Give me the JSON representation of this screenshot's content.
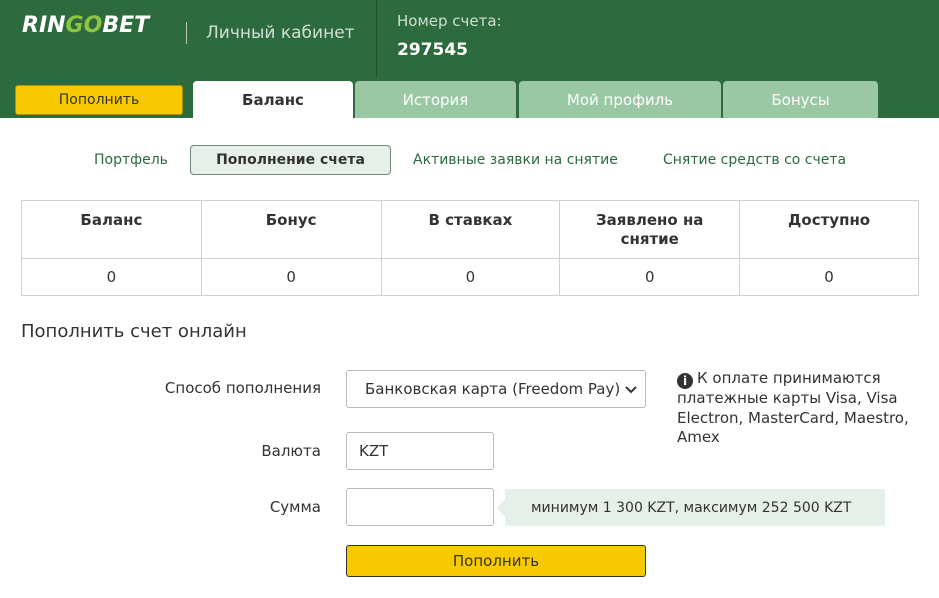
{
  "header": {
    "logo": {
      "part1": "RIN",
      "part2": "GO",
      "part3": "BET"
    },
    "cabinet_label": "Личный кабинет",
    "account_label": "Номер счета:",
    "account_number": "297545"
  },
  "tabs": {
    "topup_button": "Пополнить",
    "items": [
      {
        "label": "Баланс",
        "active": true
      },
      {
        "label": "История",
        "active": false
      },
      {
        "label": "Мой профиль",
        "active": false
      },
      {
        "label": "Бонусы",
        "active": false
      }
    ]
  },
  "subnav": [
    {
      "label": "Портфель",
      "active": false
    },
    {
      "label": "Пополнение счета",
      "active": true
    },
    {
      "label": "Активные заявки на снятие",
      "active": false
    },
    {
      "label": "Снятие средств со счета",
      "active": false
    }
  ],
  "balance_table": {
    "headers": [
      "Баланс",
      "Бонус",
      "В ставках",
      "Заявлено на снятие",
      "Доступно"
    ],
    "values": [
      "0",
      "0",
      "0",
      "0",
      "0"
    ]
  },
  "form": {
    "title": "Пополнить счет онлайн",
    "method_label": "Способ пополнения",
    "method_value": "Банковская карта (Freedom Pay)",
    "currency_label": "Валюта",
    "currency_value": "KZT",
    "amount_label": "Сумма",
    "amount_value": "",
    "info_text": "К оплате принимаются платежные карты Visa, Visa Electron, MasterCard, Maestro, Amex",
    "limits_text": "минимум 1 300 KZT,  максимум 252 500 KZT",
    "submit_label": "Пополнить"
  },
  "colors": {
    "header_bg": "#2d6a3e",
    "tab_inactive_bg": "#9bc8a4",
    "button_yellow": "#f7c900",
    "logo_accent": "#8ec63f"
  }
}
